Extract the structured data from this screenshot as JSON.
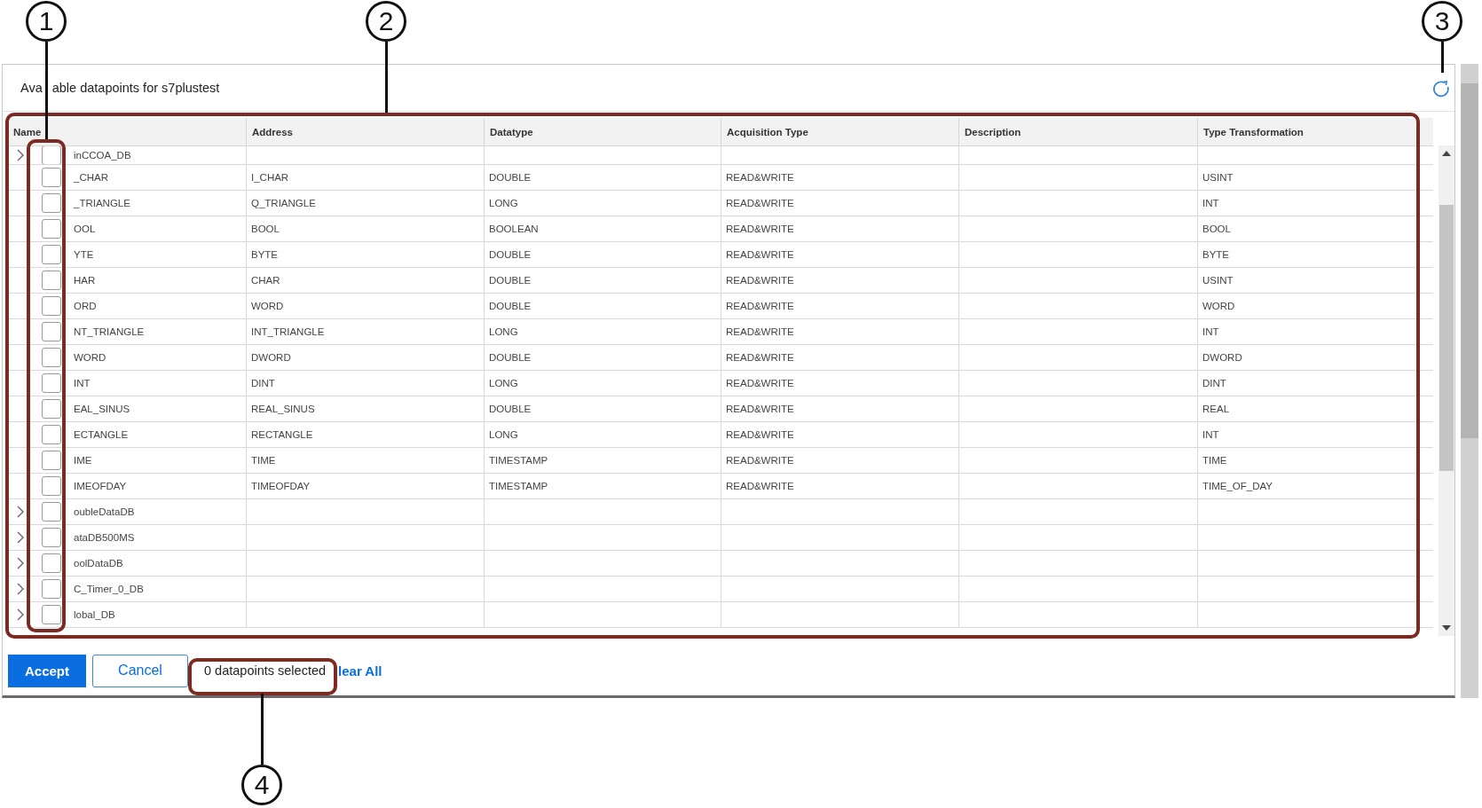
{
  "dialog": {
    "title_parts": [
      "Ava",
      "able datapoints for s7plustest"
    ]
  },
  "table": {
    "columns": [
      "Name",
      "Address",
      "Datatype",
      "Acquisition Type",
      "Description",
      "Type Transformation"
    ],
    "rows": [
      {
        "kind": "group",
        "checked": false,
        "name": "inCCOA_DB"
      },
      {
        "kind": "item",
        "checked": false,
        "name": "_CHAR",
        "address": "I_CHAR",
        "datatype": "DOUBLE",
        "acquisition_type": "READ&WRITE",
        "type_transformation": "USINT"
      },
      {
        "kind": "item",
        "checked": false,
        "name": "_TRIANGLE",
        "address": "Q_TRIANGLE",
        "datatype": "LONG",
        "acquisition_type": "READ&WRITE",
        "type_transformation": "INT"
      },
      {
        "kind": "item",
        "checked": false,
        "name": "OOL",
        "address": "BOOL",
        "datatype": "BOOLEAN",
        "acquisition_type": "READ&WRITE",
        "type_transformation": "BOOL"
      },
      {
        "kind": "item",
        "checked": false,
        "name": "YTE",
        "address": "BYTE",
        "datatype": "DOUBLE",
        "acquisition_type": "READ&WRITE",
        "type_transformation": "BYTE"
      },
      {
        "kind": "item",
        "checked": false,
        "name": "HAR",
        "address": "CHAR",
        "datatype": "DOUBLE",
        "acquisition_type": "READ&WRITE",
        "type_transformation": "USINT"
      },
      {
        "kind": "item",
        "checked": false,
        "name": "ORD",
        "address": "WORD",
        "datatype": "DOUBLE",
        "acquisition_type": "READ&WRITE",
        "type_transformation": "WORD"
      },
      {
        "kind": "item",
        "checked": false,
        "name": "NT_TRIANGLE",
        "address": "INT_TRIANGLE",
        "datatype": "LONG",
        "acquisition_type": "READ&WRITE",
        "type_transformation": "INT"
      },
      {
        "kind": "item",
        "checked": false,
        "name": "WORD",
        "address": "DWORD",
        "datatype": "DOUBLE",
        "acquisition_type": "READ&WRITE",
        "type_transformation": "DWORD"
      },
      {
        "kind": "item",
        "checked": false,
        "name": "INT",
        "address": "DINT",
        "datatype": "LONG",
        "acquisition_type": "READ&WRITE",
        "type_transformation": "DINT"
      },
      {
        "kind": "item",
        "checked": false,
        "name": "EAL_SINUS",
        "address": "REAL_SINUS",
        "datatype": "DOUBLE",
        "acquisition_type": "READ&WRITE",
        "type_transformation": "REAL"
      },
      {
        "kind": "item",
        "checked": false,
        "name": "ECTANGLE",
        "address": "RECTANGLE",
        "datatype": "LONG",
        "acquisition_type": "READ&WRITE",
        "type_transformation": "INT"
      },
      {
        "kind": "item",
        "checked": false,
        "name": "IME",
        "address": "TIME",
        "datatype": "TIMESTAMP",
        "acquisition_type": "READ&WRITE",
        "type_transformation": "TIME"
      },
      {
        "kind": "item",
        "checked": false,
        "name": "IMEOFDAY",
        "address": "TIMEOFDAY",
        "datatype": "TIMESTAMP",
        "acquisition_type": "READ&WRITE",
        "type_transformation": "TIME_OF_DAY"
      },
      {
        "kind": "group",
        "checked": false,
        "name": "oubleDataDB"
      },
      {
        "kind": "group",
        "checked": false,
        "name": "ataDB500MS"
      },
      {
        "kind": "group",
        "checked": false,
        "name": "oolDataDB"
      },
      {
        "kind": "group",
        "checked": false,
        "name": "C_Timer_0_DB"
      },
      {
        "kind": "group",
        "checked": false,
        "name": "lobal_DB"
      }
    ]
  },
  "footer": {
    "accept": "Accept",
    "cancel": "Cancel",
    "status": "0 datapoints selected",
    "clear": "lear All"
  },
  "callouts": [
    "1",
    "2",
    "3",
    "4"
  ]
}
